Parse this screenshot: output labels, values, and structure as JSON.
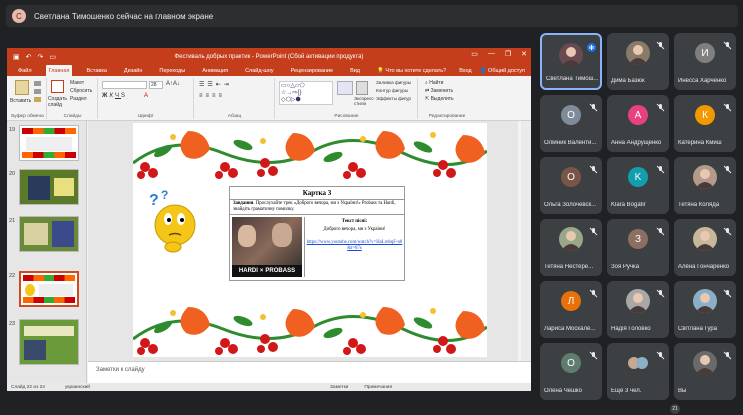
{
  "meet": {
    "presenter_initial": "С",
    "presenter_banner": "Светлана Тимошенко сейчас на главном экране",
    "colors": {
      "bg": "#202124",
      "tile": "#3c4043",
      "accent": "#8ab4f8"
    }
  },
  "ppt": {
    "window_title": "Фестиваль добрых практик - PowerPoint (Сбой активации продукта)",
    "tabs": [
      "Файл",
      "Главная",
      "Вставка",
      "Дизайн",
      "Переходы",
      "Анимация",
      "Слайд-шоу",
      "Рецензирование",
      "Вид",
      "Что вы хотите сделать?"
    ],
    "right_actions": [
      "Вход",
      "Общий доступ"
    ],
    "ribbon": {
      "paste": "Вставить",
      "create_slide": "Создать слайд",
      "layout": "Макет",
      "reset": "Сбросить",
      "section": "Раздел",
      "font_name": "",
      "font_size": "28",
      "express_styles": "Экспресс-стили",
      "fill": "Заливка фигуры",
      "outline": "Контур фигуры",
      "effects": "Эффекты фигур",
      "find": "Найти",
      "replace": "Заменить",
      "select": "Выделить",
      "groups": [
        "Буфер обмена",
        "Слайды",
        "Шрифт",
        "Абзац",
        "Рисование",
        "Редактирование"
      ]
    },
    "thumb_numbers": [
      "19",
      "20",
      "21",
      "22",
      "23"
    ],
    "slide": {
      "card_title": "Картка 3",
      "task_bold": "Завдання",
      "task_rest": ". Прослухайте трек «Доброго вечора, ми з України!» Probass та Hardi, знайдіть граматичну помилку.",
      "song_title": "Текст пісні:",
      "song_line": "Доброго вечора, ми з України!",
      "link": "https://www.youtube.com/watch?v=HaLrebqF-n8&t=87s",
      "video_caption_left": "HARDI",
      "video_caption_mid": "×",
      "video_caption_right": "PROBASS"
    },
    "notes_placeholder": "Заметки к слайду",
    "status": {
      "slide": "Слайд 22 из 24",
      "lang": "украинский",
      "notes": "Заметки",
      "comments": "Примечания"
    }
  },
  "participants": [
    {
      "name": "Светлана Тимош...",
      "initial": "",
      "color": "#6a4a52",
      "photo": true
    },
    {
      "name": "Дима Базюк",
      "initial": "",
      "color": "#8a7a6a",
      "photo": true
    },
    {
      "name": "Инесса Харченко",
      "initial": "И",
      "color": "#7f7f7f"
    },
    {
      "name": "Олійник Валенти...",
      "initial": "О",
      "color": "#7e8c9a"
    },
    {
      "name": "Анна Андрущенко",
      "initial": "А",
      "color": "#e8417f"
    },
    {
      "name": "Катерина Кмиш",
      "initial": "К",
      "color": "#f29900"
    },
    {
      "name": "Ольга Золочевск...",
      "initial": "О",
      "color": "#795548"
    },
    {
      "name": "Klara Bogatir",
      "initial": "K",
      "color": "#129eaf"
    },
    {
      "name": "Тетяна Коляда",
      "initial": "",
      "color": "#b39a8a",
      "photo": true
    },
    {
      "name": "Тетяна Нестере...",
      "initial": "",
      "color": "#9aa88a",
      "photo": true
    },
    {
      "name": "Зоя Ручка",
      "initial": "З",
      "color": "#8d6e63"
    },
    {
      "name": "Алёна Гончаренко",
      "initial": "",
      "color": "#c8b89a",
      "photo": true
    },
    {
      "name": "Лариса Москале...",
      "initial": "Л",
      "color": "#e8710a"
    },
    {
      "name": "Надія Головко",
      "initial": "",
      "color": "#a8a8a8",
      "photo": true
    },
    {
      "name": "Світлана Гура",
      "initial": "",
      "color": "#8ab0c8",
      "photo": true
    },
    {
      "name": "Олена Чешко",
      "initial": "О",
      "color": "#5f7d6e"
    },
    {
      "name": "Ещё 3 чел.",
      "initial": "",
      "color": "#5f6368",
      "group": true
    },
    {
      "name": "Вы",
      "initial": "",
      "color": "#6a6a6a",
      "photo": true
    }
  ],
  "self_badge": "21"
}
